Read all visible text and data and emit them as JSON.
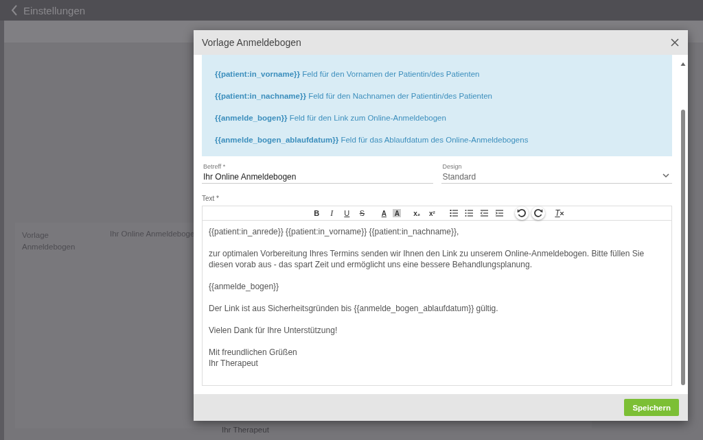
{
  "app_bar": {
    "title": "Einstellungen"
  },
  "background": {
    "label": "Vorlage Anmeldebogen",
    "value": "Ihr Online Anmeldeboge",
    "footer_text": "Ihr Therapeut"
  },
  "dialog": {
    "title": "Vorlage Anmeldebogen",
    "placeholders": [
      "**{{patient:in_vorname}}** Feld für den Vornamen der Patientin/des Patienten",
      "**{{patient:in_nachname}}** Feld für den Nachnamen der Patientin/des Patienten",
      "**{{anmelde_bogen}}** Feld für den Link zum Online-Anmeldebogen",
      "**{{anmelde_bogen_ablaufdatum}}** Feld für das Ablaufdatum des Online-Anmeldebogens"
    ],
    "subject": {
      "label": "Betreff *",
      "value": "Ihr Online Anmeldebogen"
    },
    "design": {
      "label": "Design",
      "value": "Standard"
    },
    "text_label": "Text *",
    "toolbar": [
      [
        {
          "kind": "bold",
          "label": "B"
        },
        {
          "kind": "italic",
          "label": "I"
        },
        {
          "kind": "underline",
          "label": "U"
        },
        {
          "kind": "strike",
          "label": "S"
        }
      ],
      [
        {
          "kind": "color",
          "label": "A"
        },
        {
          "kind": "highlight",
          "label": "A"
        }
      ],
      [
        {
          "kind": "script",
          "label": "x₂"
        },
        {
          "kind": "script",
          "label": "x²"
        }
      ],
      [
        {
          "kind": "ordered-list"
        },
        {
          "kind": "bullet-list"
        },
        {
          "kind": "outdent"
        },
        {
          "kind": "indent"
        }
      ],
      [
        {
          "kind": "undo"
        },
        {
          "kind": "redo"
        }
      ],
      [
        {
          "kind": "clear",
          "label": "T"
        }
      ]
    ],
    "body": [
      [
        "{{patient:in_anrede}} {{patient:in_vorname}} {{patient:in_nachname}},"
      ],
      [
        "zur optimalen Vorbereitung Ihres Termins senden wir Ihnen den Link zu unserem Online-Anmeldebogen. Bitte füllen Sie diesen vorab aus - das spart Zeit und ermöglicht uns eine bessere Behandlungsplanung."
      ],
      [
        "{{anmelde_bogen}}"
      ],
      [
        "Der Link ist aus Sicherheitsgründen bis {{anmelde_bogen_ablaufdatum}} gültig."
      ],
      [
        "Vielen Dank für Ihre Unterstützung!"
      ],
      [
        "Mit freundlichen Grüßen",
        "Ihr Therapeut"
      ]
    ],
    "save_button": "Speichern"
  }
}
